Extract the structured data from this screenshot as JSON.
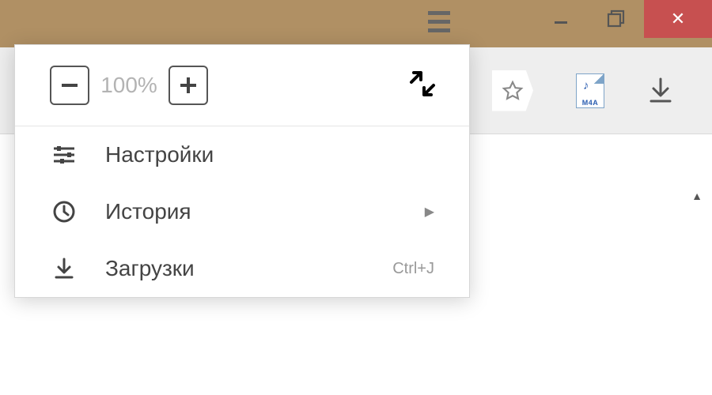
{
  "zoom": {
    "level": "100%"
  },
  "menu": {
    "settings": "Настройки",
    "history": "История",
    "downloads": "Загрузки",
    "downloads_shortcut": "Ctrl+J"
  },
  "toolbar": {
    "m4a_label": "M4A"
  },
  "window": {
    "close_glyph": "✕"
  }
}
